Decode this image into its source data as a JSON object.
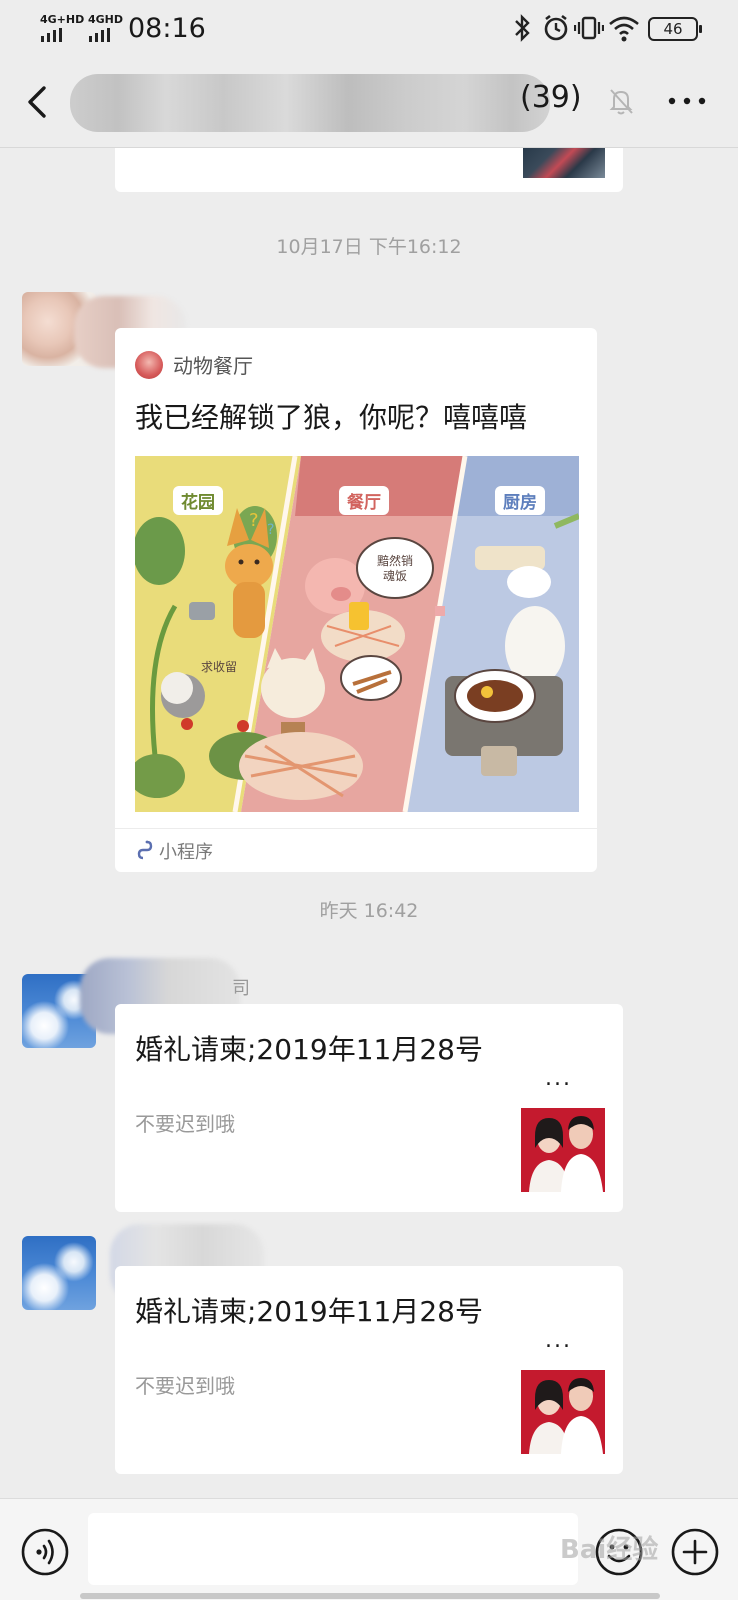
{
  "status_bar": {
    "signal1_label": "4G+HD",
    "signal2_label": "4GHD",
    "time": "08:16",
    "battery": "46"
  },
  "nav": {
    "title_suffix": "(39)"
  },
  "chat": {
    "timestamp1": "10月17日 下午16:12",
    "mini_program": {
      "source_name": "动物餐厅",
      "title": "我已经解锁了狼，你呢？嘻嘻嘻",
      "panel_labels": [
        "花园",
        "餐厅",
        "厨房"
      ],
      "bubble1": "求收留",
      "bubble2": "黯然销魂饭",
      "footer_label": "小程序"
    },
    "timestamp2": "昨天 16:42",
    "sender_partial": "司",
    "invite1": {
      "title": "婚礼请柬;2019年11月28号",
      "more": "...",
      "desc": "不要迟到哦"
    },
    "invite2": {
      "title": "婚礼请柬;2019年11月28号",
      "more": "...",
      "desc": "不要迟到哦"
    }
  },
  "input_bar": {
    "watermark": "Bai经验"
  },
  "colors": {
    "background": "#ededed",
    "card": "#ffffff",
    "accent_red": "#c9182d"
  }
}
